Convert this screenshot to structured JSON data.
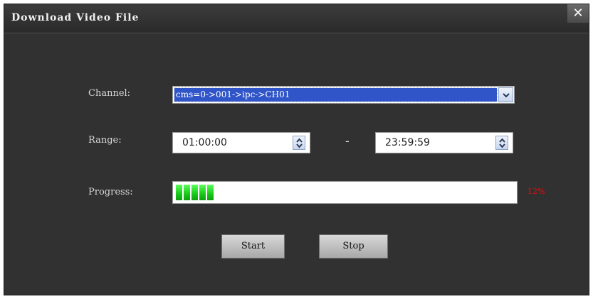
{
  "window": {
    "title": "Download Video File",
    "close_glyph": "✕"
  },
  "form": {
    "channel_label": "Channel:",
    "channel_value": "cms=0->001->ipc->CH01",
    "range_label": "Range:",
    "range_start": "01:00:00",
    "range_separator": "-",
    "range_end": "23:59:59",
    "progress_label": "Progress:",
    "progress_percent_text": "12%",
    "progress_fraction": 0.12
  },
  "buttons": {
    "start_label": "Start",
    "stop_label": "Stop"
  },
  "icons": {
    "close": "close-icon",
    "dropdown": "chevron-down-icon",
    "spinner": "up-down-arrows-icon"
  },
  "colors": {
    "dialog_bg": "#313131",
    "selection": "#2f55c8",
    "progress_fill": "#18c818",
    "percent_text": "#e01010"
  }
}
